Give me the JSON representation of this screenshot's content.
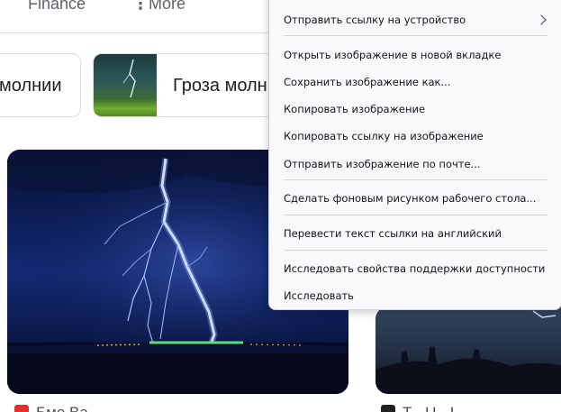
{
  "tabs": {
    "finance": "Finance",
    "more": "More",
    "more_icon": "⋮"
  },
  "chips": [
    {
      "label": "молнии"
    },
    {
      "label": "Гроза молн"
    }
  ],
  "results": [
    {
      "source": "Бмо Ва"
    },
    {
      "source": "T - U - I -"
    }
  ],
  "context_menu": {
    "items": [
      {
        "label": "Отправить ссылку на устройство",
        "has_submenu": true,
        "icon": "chevron-right-icon"
      },
      {
        "label": "Открыть изображение в новой вкладке"
      },
      {
        "label": "Сохранить изображение как..."
      },
      {
        "label": "Копировать изображение"
      },
      {
        "label": "Копировать ссылку на изображение"
      },
      {
        "label": "Отправить изображение по почте..."
      },
      {
        "label": "Сделать фоновым рисунком рабочего стола..."
      },
      {
        "label": "Перевести текст ссылки на английский"
      },
      {
        "label": "Исследовать свойства поддержки доступности"
      },
      {
        "label": "Исследовать"
      }
    ]
  },
  "colors": {
    "menu_bg": "#f9f9fb",
    "menu_text": "#15141a",
    "separator": "#d7d7db",
    "tile_sky": "#132a73",
    "lightning": "#dbe8ff"
  }
}
